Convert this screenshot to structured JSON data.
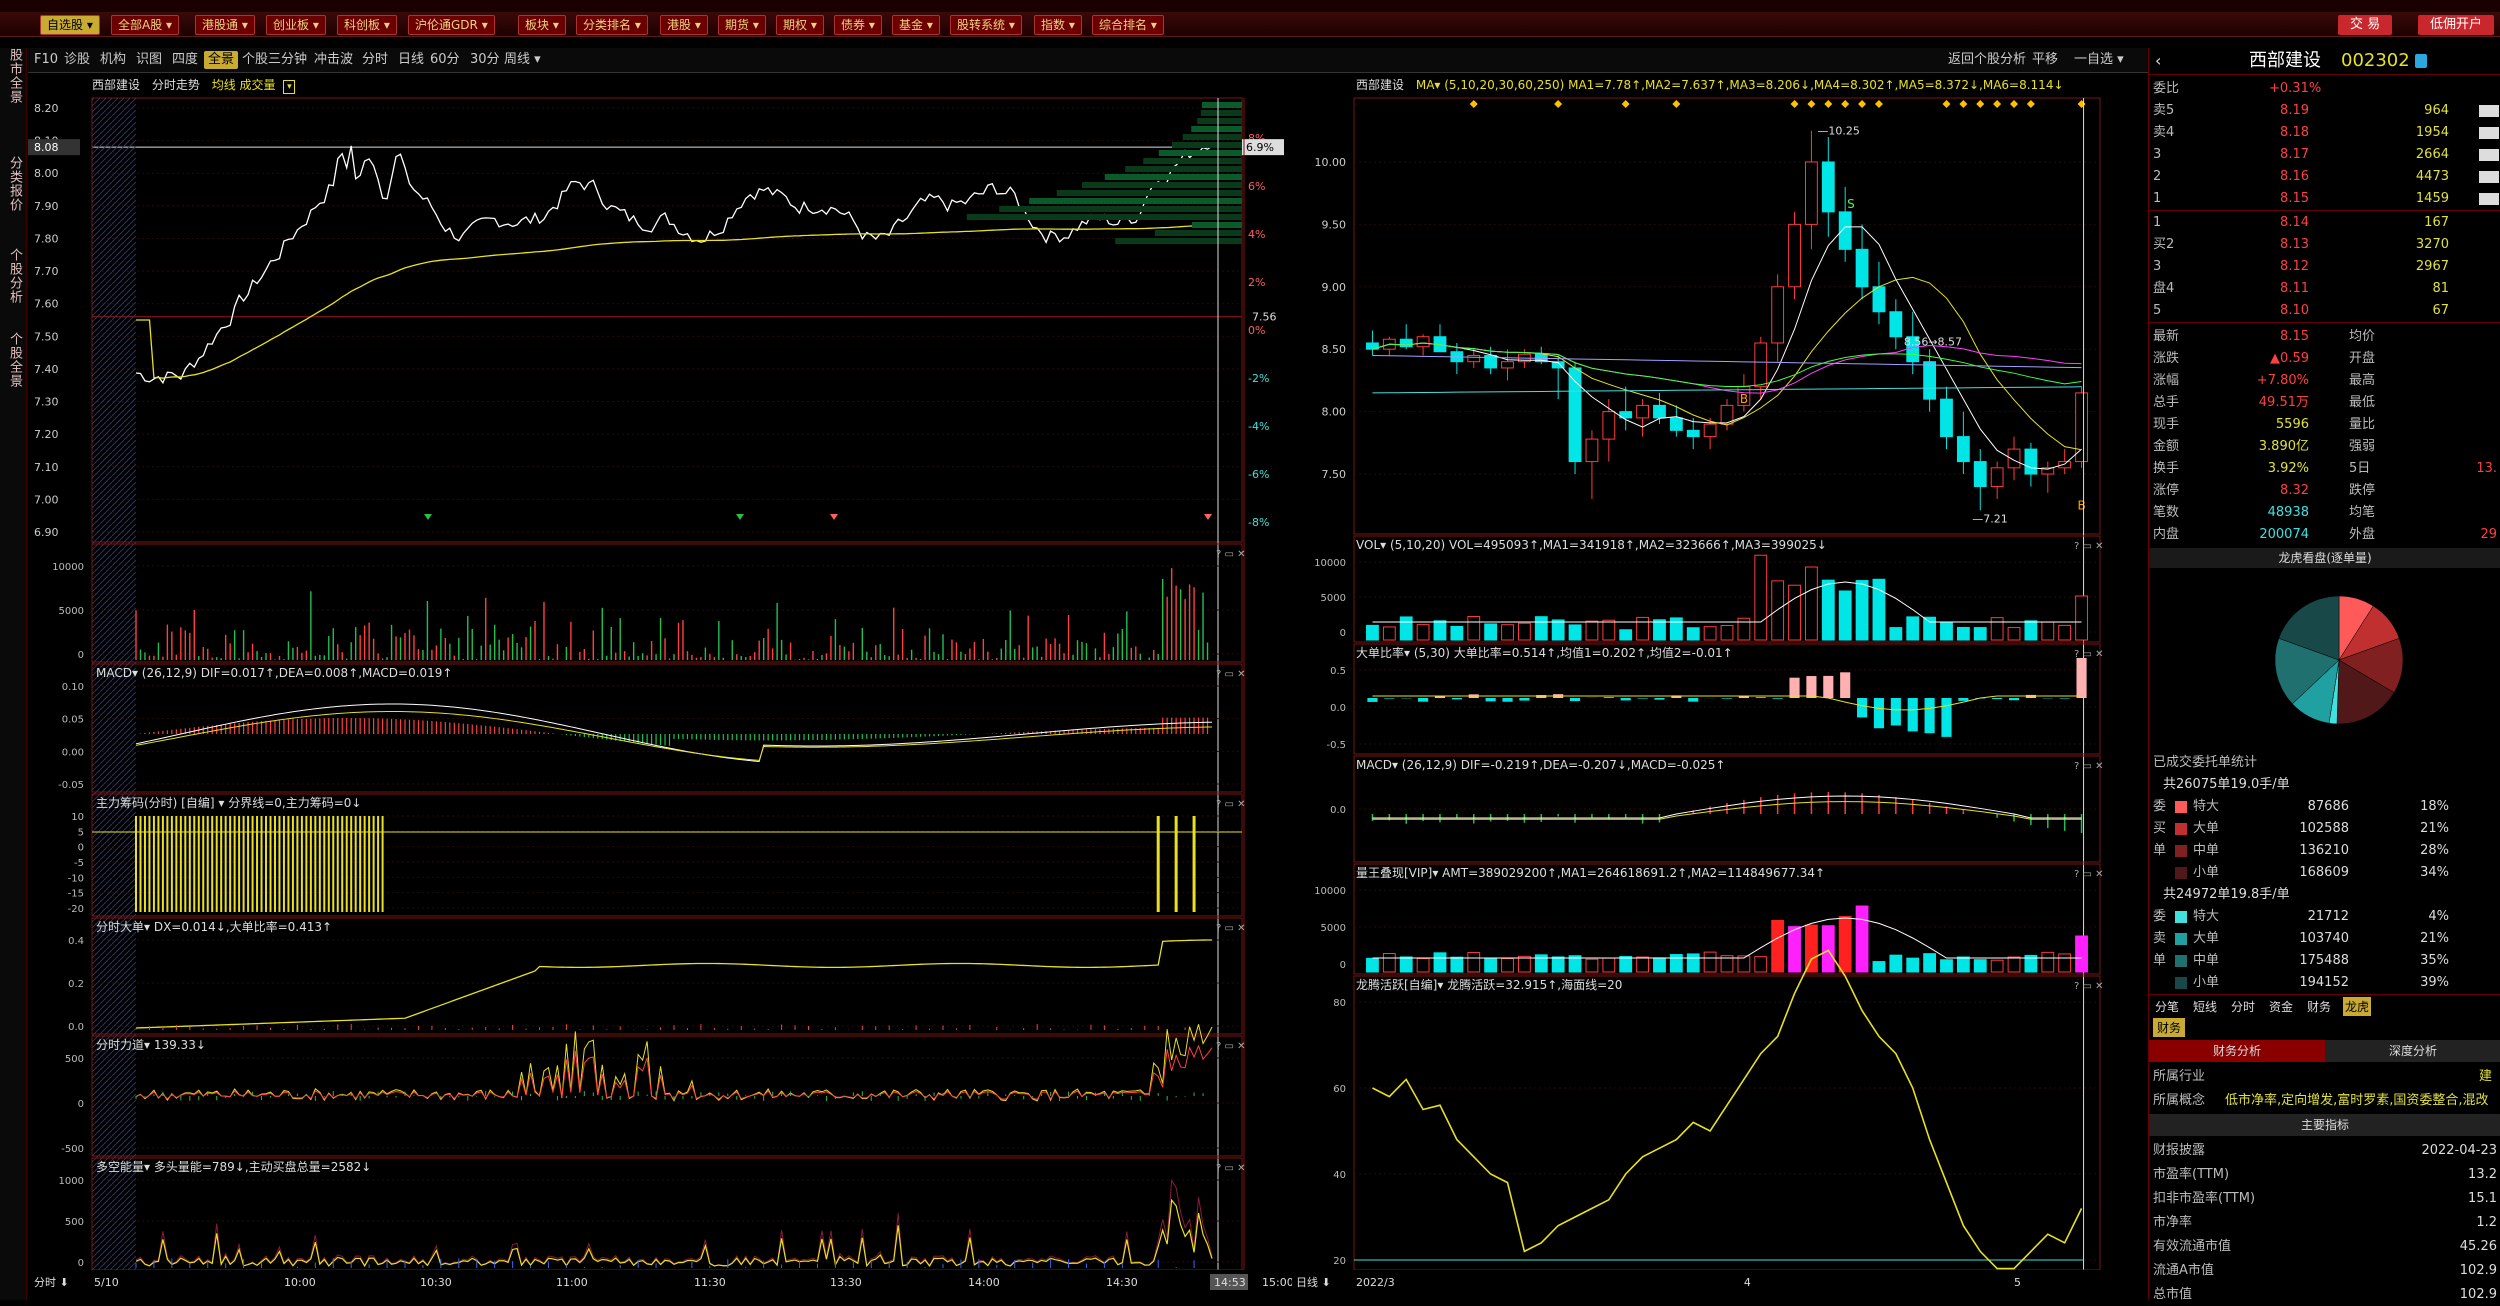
{
  "menu": {
    "items": [
      "自选股",
      "全部A股",
      "港股通",
      "创业板",
      "科创板",
      "沪伦通GDR",
      "板块",
      "分类排名",
      "港股",
      "期货",
      "期权",
      "债券",
      "基金",
      "股转系统",
      "指数",
      "综合排名"
    ],
    "active": "自选股",
    "trade": "交 易",
    "open_account": "低佣开户"
  },
  "left_tabs": [
    "股市全景",
    "分类报价",
    "个股分析",
    "个股全景"
  ],
  "toolbar": {
    "items": [
      "F10",
      "诊股",
      "机构",
      "识图",
      "四度",
      "全景",
      "个股三分钟",
      "冲击波",
      "分时",
      "日线",
      "60分",
      "30分",
      "周线"
    ],
    "selected": "全景",
    "right": [
      "返回个股分析",
      "平移",
      "一自选"
    ]
  },
  "intraday": {
    "title": "西部建设",
    "mode": "分时走势",
    "legend": "均线 成交量",
    "price_ticks": [
      "8.20",
      "8.10",
      "8.00",
      "7.90",
      "7.80",
      "7.70",
      "7.60",
      "7.50",
      "7.40",
      "7.30",
      "7.20",
      "7.10",
      "7.00",
      "6.90"
    ],
    "pct_ticks": [
      "8%",
      "6%",
      "4%",
      "2%",
      "0%",
      "-2%",
      "-4%",
      "-6%",
      "-8%"
    ],
    "current_price": "8.08",
    "current_pct": "6.9%",
    "prev_close_label": "7.56",
    "time_labels": [
      "5/10",
      "10:00",
      "10:30",
      "11:00",
      "11:30",
      "13:30",
      "14:00",
      "14:30",
      "14:53",
      "15:00"
    ],
    "left_corner": "分时"
  },
  "sub_left": [
    {
      "name": "vol",
      "title": "",
      "ticks": [
        "10000",
        "5000",
        "0"
      ]
    },
    {
      "name": "macd",
      "title": "MACD▾ (26,12,9) DIF=0.017↑,DEA=0.008↑,MACD=0.019↑",
      "ticks": [
        "0.10",
        "0.05",
        "0.00",
        "-0.05"
      ]
    },
    {
      "name": "zlcm",
      "title": "主力筹码(分时) [自编] ▾ 分界线=0,主力筹码=0↓",
      "ticks": [
        "10",
        "5",
        "0",
        "-5",
        "-10",
        "-15",
        "-20"
      ]
    },
    {
      "name": "dadan",
      "title": "分时大单▾ DX=0.014↓,大单比率=0.413↑",
      "ticks": [
        "0.4",
        "0.2",
        "0.0"
      ]
    },
    {
      "name": "lidao",
      "title": "分时力道▾ 139.33↓",
      "ticks": [
        "500",
        "0",
        "-500"
      ]
    },
    {
      "name": "duokong",
      "title": "多空能量▾ 多头量能=789↓,主动买盘总量=2582↓",
      "ticks": [
        "1000",
        "500",
        "0"
      ]
    }
  ],
  "kline": {
    "title": "西部建设",
    "ma_legend": "MA▾ (5,10,20,30,60,250) MA1=7.78↑,MA2=7.637↑,MA3=8.206↓,MA4=8.302↑,MA5=8.372↓,MA6=8.114↓",
    "price_ticks": [
      "10.00",
      "9.50",
      "9.00",
      "8.50",
      "8.00",
      "7.50"
    ],
    "high_label": "10.25",
    "low_label": "7.21",
    "range_label": "8.56→8.57",
    "date_labels": [
      "2022/3",
      "4",
      "5"
    ],
    "left_corner": "日线",
    "chart_data": {
      "type": "candlestick",
      "ohlc": [
        [
          8.55,
          8.65,
          8.45,
          8.5
        ],
        [
          8.5,
          8.6,
          8.45,
          8.58
        ],
        [
          8.58,
          8.7,
          8.5,
          8.52
        ],
        [
          8.52,
          8.62,
          8.45,
          8.6
        ],
        [
          8.6,
          8.7,
          8.5,
          8.48
        ],
        [
          8.48,
          8.55,
          8.3,
          8.4
        ],
        [
          8.4,
          8.5,
          8.35,
          8.45
        ],
        [
          8.45,
          8.52,
          8.3,
          8.35
        ],
        [
          8.35,
          8.5,
          8.25,
          8.4
        ],
        [
          8.4,
          8.5,
          8.35,
          8.46
        ],
        [
          8.46,
          8.52,
          8.38,
          8.4
        ],
        [
          8.4,
          8.45,
          8.1,
          8.35
        ],
        [
          8.35,
          8.4,
          7.5,
          7.6
        ],
        [
          7.6,
          7.85,
          7.3,
          7.78
        ],
        [
          7.78,
          8.1,
          7.6,
          8.0
        ],
        [
          8.0,
          8.2,
          7.85,
          7.95
        ],
        [
          7.95,
          8.1,
          7.8,
          8.05
        ],
        [
          8.05,
          8.15,
          7.9,
          7.95
        ],
        [
          7.95,
          8.05,
          7.8,
          7.85
        ],
        [
          7.85,
          7.95,
          7.7,
          7.8
        ],
        [
          7.8,
          7.95,
          7.7,
          7.9
        ],
        [
          7.9,
          8.1,
          7.85,
          8.05
        ],
        [
          8.05,
          8.3,
          8.0,
          8.2
        ],
        [
          8.2,
          8.6,
          8.1,
          8.55
        ],
        [
          8.55,
          9.1,
          8.4,
          9.0
        ],
        [
          9.0,
          9.6,
          8.9,
          9.5
        ],
        [
          9.5,
          10.25,
          9.3,
          10.0
        ],
        [
          10.0,
          10.2,
          9.4,
          9.6
        ],
        [
          9.6,
          9.8,
          9.2,
          9.3
        ],
        [
          9.3,
          9.5,
          8.9,
          9.0
        ],
        [
          9.0,
          9.2,
          8.7,
          8.8
        ],
        [
          8.8,
          8.9,
          8.5,
          8.6
        ],
        [
          8.6,
          8.8,
          8.3,
          8.4
        ],
        [
          8.4,
          8.5,
          8.0,
          8.1
        ],
        [
          8.1,
          8.2,
          7.7,
          7.8
        ],
        [
          7.8,
          8.0,
          7.5,
          7.6
        ],
        [
          7.6,
          7.7,
          7.21,
          7.4
        ],
        [
          7.4,
          7.6,
          7.3,
          7.55
        ],
        [
          7.55,
          7.8,
          7.45,
          7.7
        ],
        [
          7.7,
          7.75,
          7.4,
          7.5
        ],
        [
          7.5,
          7.6,
          7.35,
          7.55
        ],
        [
          7.55,
          7.7,
          7.5,
          7.6
        ],
        [
          7.6,
          8.2,
          7.55,
          8.15
        ]
      ]
    }
  },
  "sub_right": [
    {
      "name": "rvol",
      "title": "VOL▾ (5,10,20) VOL=495093↑,MA1=341918↑,MA2=323666↑,MA3=399025↓",
      "ticks": [
        "10000",
        "5000",
        "0"
      ]
    },
    {
      "name": "ddbl",
      "title": "大单比率▾ (5,30) 大单比率=0.514↑,均值1=0.202↑,均值2=-0.01↑",
      "ticks": [
        "0.5",
        "0.0",
        "-0.5"
      ]
    },
    {
      "name": "rmacd",
      "title": "MACD▾ (26,12,9) DIF=-0.219↑,DEA=-0.207↓,MACD=-0.025↑",
      "ticks": [
        "0.0"
      ]
    },
    {
      "name": "lwdl",
      "title": "量王叠现[VIP]▾ AMT=389029200↑,MA1=264618691.2↑,MA2=114849677.34↑",
      "ticks": [
        "10000",
        "5000",
        "0"
      ]
    },
    {
      "name": "lthy",
      "title": "龙腾活跃[自编]▾ 龙腾活跃=32.915↑,海面线=20",
      "ticks": [
        "80",
        "60",
        "40",
        "20"
      ]
    }
  ],
  "quote": {
    "name": "西部建设",
    "code": "002302",
    "webi_label": "委比",
    "webi_value": "+0.31%",
    "sell": [
      {
        "label": "卖5",
        "price": "8.19",
        "vol": "964"
      },
      {
        "label": "卖4",
        "price": "8.18",
        "vol": "1954"
      },
      {
        "label": "3",
        "price": "8.17",
        "vol": "2664"
      },
      {
        "label": "2",
        "price": "8.16",
        "vol": "4473"
      },
      {
        "label": "1",
        "price": "8.15",
        "vol": "1459"
      }
    ],
    "buy": [
      {
        "label": "1",
        "price": "8.14",
        "vol": "167"
      },
      {
        "label": "买2",
        "price": "8.13",
        "vol": "3270"
      },
      {
        "label": "3",
        "price": "8.12",
        "vol": "2967"
      },
      {
        "label": "盘4",
        "price": "8.11",
        "vol": "81"
      },
      {
        "label": "5",
        "price": "8.10",
        "vol": "67"
      }
    ],
    "stats": [
      {
        "l1": "最新",
        "v1": "8.15",
        "l2": "均价",
        "c1": "#ff4040"
      },
      {
        "l1": "涨跌",
        "v1": "▲0.59",
        "l2": "开盘",
        "c1": "#ff4040"
      },
      {
        "l1": "涨幅",
        "v1": "+7.80%",
        "l2": "最高",
        "c1": "#ff4040"
      },
      {
        "l1": "总手",
        "v1": "49.51万",
        "l2": "最低",
        "c1": "#ff4040"
      },
      {
        "l1": "现手",
        "v1": "5596",
        "l2": "量比",
        "c1": "#e0e040"
      },
      {
        "l1": "金额",
        "v1": "3.890亿",
        "l2": "强弱",
        "c1": "#e0e040"
      },
      {
        "l1": "换手",
        "v1": "3.92%",
        "l2": "5日",
        "c1": "#e0e040"
      },
      {
        "l1": "涨停",
        "v1": "8.32",
        "l2": "跌停",
        "c1": "#ff4040"
      },
      {
        "l1": "笔数",
        "v1": "48938",
        "l2": "均笔",
        "c1": "#40e0e0"
      },
      {
        "l1": "内盘",
        "v1": "200074",
        "l2": "外盘",
        "c1": "#40e0e0"
      }
    ],
    "right_col": [
      "",
      "",
      "",
      "",
      "",
      "",
      "",
      "",
      "13.",
      "",
      "",
      "29"
    ],
    "donut_title": "龙虎看盘(逐单量)",
    "entrust_title": "已成交委托单统计",
    "buy_summary": "共26075单19.0手/单",
    "sell_summary": "共24972单19.8手/单",
    "buy_rows": [
      {
        "side": "委",
        "type": "特大",
        "num": "87686",
        "pct": "18%",
        "color": "#ff5a5a"
      },
      {
        "side": "买",
        "type": "大单",
        "num": "102588",
        "pct": "21%",
        "color": "#c03030"
      },
      {
        "side": "单",
        "type": "中单",
        "num": "136210",
        "pct": "28%",
        "color": "#802020"
      },
      {
        "side": "",
        "type": "小单",
        "num": "168609",
        "pct": "34%",
        "color": "#501818"
      }
    ],
    "sell_rows": [
      {
        "side": "委",
        "type": "特大",
        "num": "21712",
        "pct": "4%",
        "color": "#40e0e0"
      },
      {
        "side": "卖",
        "type": "大单",
        "num": "103740",
        "pct": "21%",
        "color": "#20a0a0"
      },
      {
        "side": "单",
        "type": "中单",
        "num": "175488",
        "pct": "35%",
        "color": "#207070"
      },
      {
        "side": "",
        "type": "小单",
        "num": "194152",
        "pct": "39%",
        "color": "#184848"
      }
    ],
    "tabs": [
      "分笔",
      "短线",
      "分时",
      "资金",
      "财务",
      "龙虎"
    ],
    "tab_active": "龙虎",
    "fin_tab": "财务",
    "fin_sub": [
      "财务分析",
      "深度分析"
    ],
    "industry_label": "所属行业",
    "industry_value": "建",
    "concept_label": "所属概念",
    "concept_value": "低市净率,定向增发,富时罗素,国资委整合,混改",
    "main_index": "主要指标",
    "fin_rows": [
      {
        "l": "财报披露",
        "v": "2022-04-23"
      },
      {
        "l": "市盈率(TTM)",
        "v": "13.2"
      },
      {
        "l": "扣非市盈率(TTM)",
        "v": "15.1"
      },
      {
        "l": "市净率",
        "v": "1.2"
      },
      {
        "l": "有效流通市值",
        "v": "45.26"
      },
      {
        "l": "流通A市值",
        "v": "102.9"
      },
      {
        "l": "总市值",
        "v": "102.9"
      }
    ]
  },
  "colors": {
    "up": "#ff3b3b",
    "down": "#00e5e5",
    "grid": "#7a1515",
    "yellow": "#e8e020",
    "white": "#ffffff"
  }
}
